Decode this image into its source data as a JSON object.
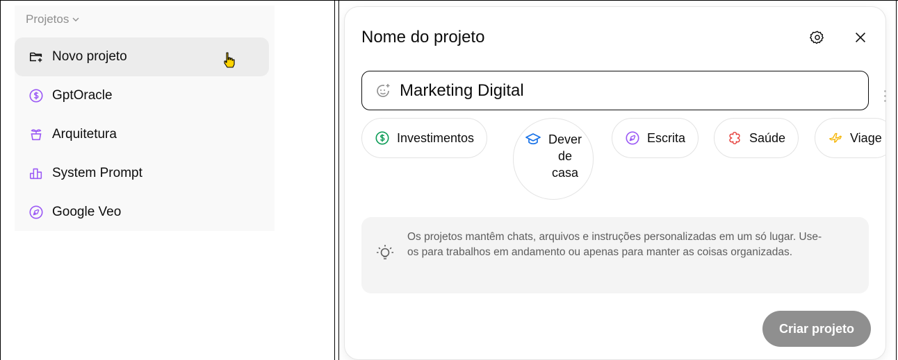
{
  "sidebar": {
    "section_title": "Projetos",
    "items": [
      {
        "label": "Novo projeto",
        "icon": "folder-plus-icon",
        "color": "#0d0d0d"
      },
      {
        "label": "GptOracle",
        "icon": "dollar-circle-icon",
        "color": "#9b59f5"
      },
      {
        "label": "Arquitetura",
        "icon": "plant-pot-icon",
        "color": "#9b59f5"
      },
      {
        "label": "System Prompt",
        "icon": "bar-chart-icon",
        "color": "#9b59f5"
      },
      {
        "label": "Google Veo",
        "icon": "pen-nib-icon",
        "color": "#9b59f5"
      }
    ]
  },
  "modal": {
    "title": "Nome do projeto",
    "name_value": "Marketing Digital",
    "chips": [
      {
        "label": "Investimentos",
        "icon": "dollar-circle-icon",
        "color": "#0f9d58"
      },
      {
        "label": "Dever de casa",
        "icon": "graduation-cap-icon",
        "color": "#1a73e8"
      },
      {
        "label": "Escrita",
        "icon": "pen-nib-icon",
        "color": "#9b59f5"
      },
      {
        "label": "Saúde",
        "icon": "health-cross-icon",
        "color": "#e53935"
      },
      {
        "label": "Viage",
        "icon": "airplane-icon",
        "color": "#f5b400"
      }
    ],
    "info_text": "Os projetos mantêm chats, arquivos e instruções personalizadas em um só lugar. Use-os para trabalhos em andamento ou apenas para manter as coisas organizadas.",
    "create_label": "Criar projeto",
    "create_color": "#8f8f8f"
  }
}
